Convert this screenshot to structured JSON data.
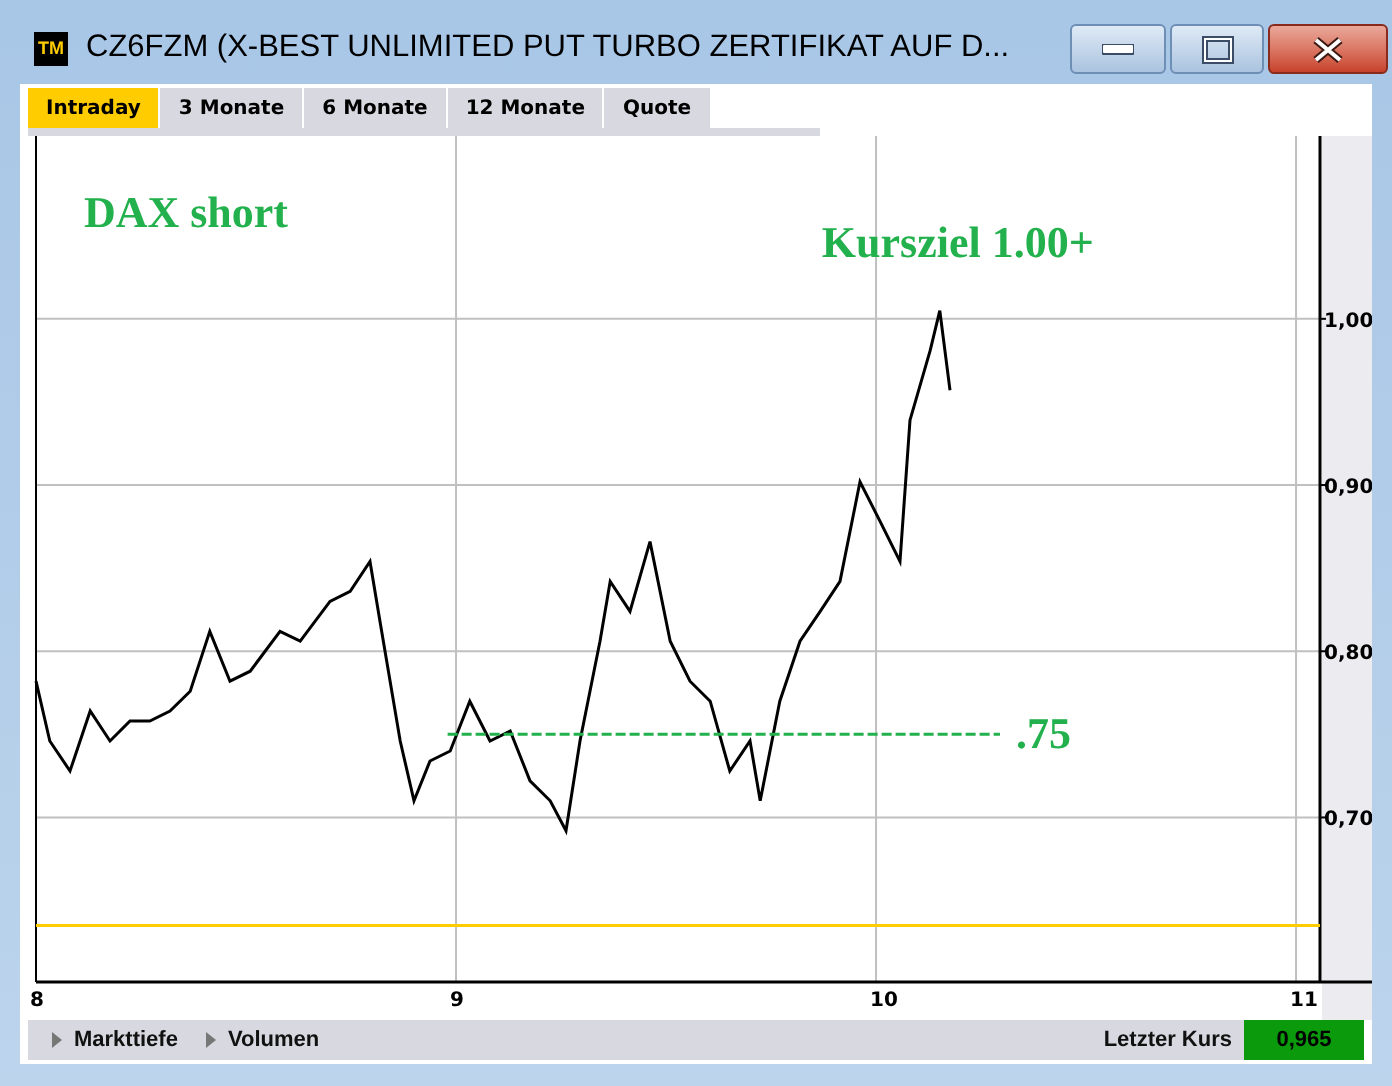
{
  "window": {
    "title": "CZ6FZM (X-BEST UNLIMITED PUT TURBO ZERTIFIKAT AUF D...",
    "logo": "TM"
  },
  "tabs": [
    {
      "label": "Intraday",
      "selected": true
    },
    {
      "label": "3 Monate",
      "selected": false
    },
    {
      "label": "6 Monate",
      "selected": false
    },
    {
      "label": "12 Monate",
      "selected": false
    },
    {
      "label": "Quote",
      "selected": false
    }
  ],
  "chart": {
    "chart_data": {
      "type": "line",
      "xlim": [
        8,
        11.057
      ],
      "ylim": [
        0.601,
        1.11
      ],
      "xticks": [
        8,
        9,
        10,
        11
      ],
      "yticks": [
        {
          "value": 0.7,
          "label": "0,70"
        },
        {
          "value": 0.8,
          "label": "0,80"
        },
        {
          "value": 0.9,
          "label": "0,90"
        },
        {
          "value": 1.0,
          "label": "1,00"
        }
      ],
      "x": [
        8.0,
        8.033,
        8.081,
        8.129,
        8.176,
        8.224,
        8.271,
        8.319,
        8.367,
        8.414,
        8.462,
        8.51,
        8.581,
        8.629,
        8.7,
        8.748,
        8.795,
        8.819,
        8.867,
        8.9,
        8.938,
        8.986,
        9.033,
        9.081,
        9.129,
        9.176,
        9.224,
        9.262,
        9.295,
        9.343,
        9.367,
        9.414,
        9.462,
        9.51,
        9.557,
        9.605,
        9.652,
        9.7,
        9.724,
        9.771,
        9.819,
        9.867,
        9.914,
        9.962,
        10.01,
        10.057,
        10.081,
        10.129,
        10.152,
        10.176
      ],
      "series": [
        {
          "color": "#000000",
          "values": [
            0.782,
            0.746,
            0.728,
            0.764,
            0.746,
            0.758,
            0.758,
            0.764,
            0.776,
            0.812,
            0.782,
            0.788,
            0.812,
            0.806,
            0.83,
            0.836,
            0.854,
            0.818,
            0.746,
            0.71,
            0.734,
            0.74,
            0.77,
            0.746,
            0.752,
            0.722,
            0.71,
            0.692,
            0.746,
            0.806,
            0.842,
            0.824,
            0.866,
            0.806,
            0.782,
            0.77,
            0.728,
            0.746,
            0.71,
            0.77,
            0.806,
            0.824,
            0.842,
            0.902,
            0.878,
            0.854,
            0.939,
            0.981,
            1.005,
            0.957
          ]
        }
      ],
      "grid": true,
      "annotations": [
        "DAX short",
        "Kursziel 1.00+"
      ],
      "ref_lines": [
        {
          "axis": "y",
          "value": 0.75,
          "label": ".75",
          "color": "#22b14c"
        },
        {
          "axis": "y",
          "value": 0.635,
          "color": "#ffcc00"
        }
      ]
    }
  },
  "bottom_bar": {
    "links": [
      "Markttiefe",
      "Volumen"
    ],
    "last_price_label": "Letzter Kurs",
    "last_price": "0,965"
  }
}
